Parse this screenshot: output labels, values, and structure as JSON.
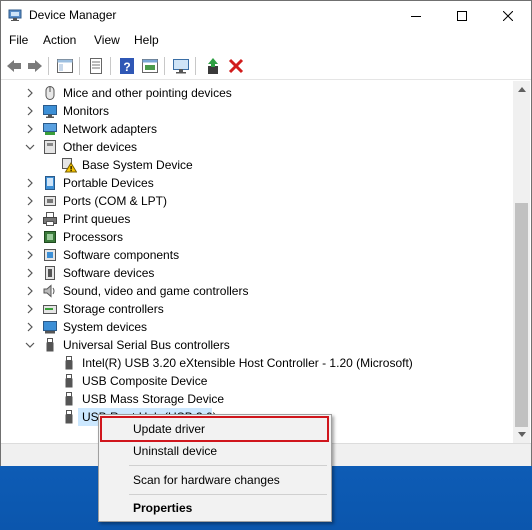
{
  "window": {
    "title": "Device Manager",
    "buttons": {
      "minimize": "minimize-icon",
      "maximize": "maximize-icon",
      "close": "close-icon"
    }
  },
  "menu": [
    "File",
    "Action",
    "View",
    "Help"
  ],
  "toolbar": {
    "icons": [
      "back-arrow-icon",
      "forward-arrow-icon",
      "show-hide-tree-icon",
      "properties-icon",
      "help-icon",
      "view-icon",
      "scan-hardware-icon",
      "update-driver-icon",
      "uninstall-device-icon"
    ]
  },
  "tree": {
    "items": [
      {
        "label": "Mice and other pointing devices",
        "icon": "mouse-icon",
        "state": "collapsed",
        "level": 0
      },
      {
        "label": "Monitors",
        "icon": "monitor-icon",
        "state": "collapsed",
        "level": 0
      },
      {
        "label": "Network adapters",
        "icon": "network-icon",
        "state": "collapsed",
        "level": 0
      },
      {
        "label": "Other devices",
        "icon": "other-devices-icon",
        "state": "expanded",
        "level": 0
      },
      {
        "label": "Base System Device",
        "icon": "warning-device-icon",
        "state": "leaf",
        "level": 1
      },
      {
        "label": "Portable Devices",
        "icon": "portable-device-icon",
        "state": "collapsed",
        "level": 0
      },
      {
        "label": "Ports (COM & LPT)",
        "icon": "port-icon",
        "state": "collapsed",
        "level": 0
      },
      {
        "label": "Print queues",
        "icon": "printer-icon",
        "state": "collapsed",
        "level": 0
      },
      {
        "label": "Processors",
        "icon": "processor-icon",
        "state": "collapsed",
        "level": 0
      },
      {
        "label": "Software components",
        "icon": "software-component-icon",
        "state": "collapsed",
        "level": 0
      },
      {
        "label": "Software devices",
        "icon": "software-device-icon",
        "state": "collapsed",
        "level": 0
      },
      {
        "label": "Sound, video and game controllers",
        "icon": "speaker-icon",
        "state": "collapsed",
        "level": 0
      },
      {
        "label": "Storage controllers",
        "icon": "storage-icon",
        "state": "collapsed",
        "level": 0
      },
      {
        "label": "System devices",
        "icon": "system-device-icon",
        "state": "collapsed",
        "level": 0
      },
      {
        "label": "Universal Serial Bus controllers",
        "icon": "usb-icon",
        "state": "expanded",
        "level": 0
      },
      {
        "label": "Intel(R) USB 3.20 eXtensible Host Controller - 1.20 (Microsoft)",
        "icon": "usb-icon",
        "state": "leaf",
        "level": 1
      },
      {
        "label": "USB Composite Device",
        "icon": "usb-icon",
        "state": "leaf",
        "level": 1
      },
      {
        "label": "USB Mass Storage Device",
        "icon": "usb-icon",
        "state": "leaf",
        "level": 1
      },
      {
        "label": "USB Root Hub (USB 3.0)",
        "icon": "usb-icon",
        "state": "selected",
        "level": 1
      }
    ]
  },
  "context_menu": {
    "items": [
      {
        "label": "Update driver",
        "bold": false,
        "highlighted": true
      },
      {
        "label": "Uninstall device",
        "bold": false
      },
      {
        "label": "Scan for hardware changes",
        "bold": false
      },
      {
        "label": "Properties",
        "bold": true
      }
    ]
  },
  "colors": {
    "selection": "#cce8ff",
    "highlight_border": "#d0161d",
    "desktop": "#0d5fbf"
  }
}
